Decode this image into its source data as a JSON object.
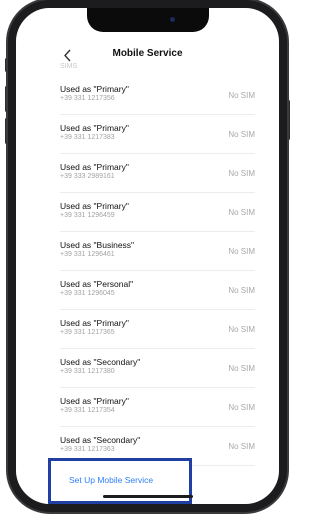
{
  "nav": {
    "title": "Mobile Service",
    "back_icon": "chevron-left-icon",
    "faded_label": "SIMS"
  },
  "rows": [
    {
      "title": "Used as \"Primary\"",
      "number": "+39 331 1217356",
      "status": "No SIM"
    },
    {
      "title": "Used as \"Primary\"",
      "number": "+39 331 1217383",
      "status": "No SIM"
    },
    {
      "title": "Used as \"Primary\"",
      "number": "+39 333 2989161",
      "status": "No SIM"
    },
    {
      "title": "Used as \"Primary\"",
      "number": "+39 331 1296459",
      "status": "No SIM"
    },
    {
      "title": "Used as \"Business\"",
      "number": "+39 331 1296461",
      "status": "No SIM"
    },
    {
      "title": "Used as \"Personal\"",
      "number": "+39 331 1296045",
      "status": "No SIM"
    },
    {
      "title": "Used as \"Primary\"",
      "number": "+39 331 1217365",
      "status": "No SIM"
    },
    {
      "title": "Used as \"Secondary\"",
      "number": "+39 331 1217380",
      "status": "No SIM"
    },
    {
      "title": "Used as \"Primary\"",
      "number": "+39 331 1217354",
      "status": "No SIM"
    },
    {
      "title": "Used as \"Secondary\"",
      "number": "+39 331 1217363",
      "status": "No SIM"
    }
  ],
  "setup": {
    "label": "Set Up Mobile Service"
  },
  "colors": {
    "link": "#2f7ff5",
    "highlight_border": "#1f3fa3",
    "frame": "#1c1c1e"
  }
}
